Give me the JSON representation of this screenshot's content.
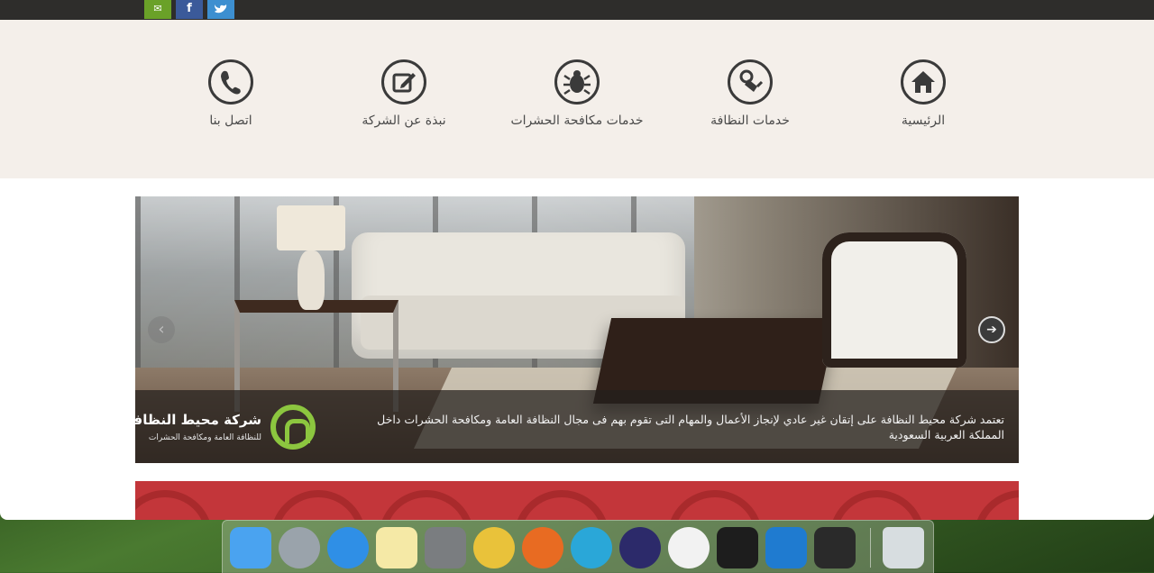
{
  "social": {
    "email_icon": "email-icon",
    "facebook_glyph": "f",
    "twitter_icon": "twitter-icon",
    "email_glyph": "✉"
  },
  "nav": {
    "items": [
      {
        "label": "الرئيسية",
        "icon": "home-icon"
      },
      {
        "label": "خدمات النظافة",
        "icon": "vacuum-cleaner-icon"
      },
      {
        "label": "خدمات مكافحة الحشرات",
        "icon": "bug-icon"
      },
      {
        "label": "نبذة عن الشركة",
        "icon": "edit-icon"
      },
      {
        "label": "اتصل بنا",
        "icon": "phone-icon"
      }
    ]
  },
  "slider": {
    "caption": "تعتمد شركة محيط النظافة على إتقان غير عادي لإنجاز الأعمال والمهام التى تقوم بهم فى مجال النظافة العامة ومكافحة الحشرات داخل المملكة العربية السعودية",
    "logo_name": "شركة محيط النظافة",
    "logo_sub": "للنظافة العامة ومكافحة الحشرات",
    "prev_arrow": "‹",
    "next_arrow": "➔"
  },
  "dock": {
    "apps": [
      {
        "name": "finder-icon",
        "color": "#4aa3f0"
      },
      {
        "name": "launchpad-icon",
        "color": "#9aa3ab"
      },
      {
        "name": "safari-icon",
        "color": "#2f8fe6"
      },
      {
        "name": "notes-icon",
        "color": "#f5e9a6"
      },
      {
        "name": "system-preferences-icon",
        "color": "#7a7d80"
      },
      {
        "name": "chrome-icon",
        "color": "#e9c23a"
      },
      {
        "name": "firefox-icon",
        "color": "#e86b22"
      },
      {
        "name": "kite-icon",
        "color": "#2aa7d8"
      },
      {
        "name": "eclipse-icon",
        "color": "#2c2a6a"
      },
      {
        "name": "photos-icon",
        "color": "#f2f2f2"
      },
      {
        "name": "terminal-icon",
        "color": "#1d1d1d"
      },
      {
        "name": "vscode-icon",
        "color": "#1f7bd0"
      },
      {
        "name": "screen-app-icon",
        "color": "#2a2a2a"
      },
      {
        "name": "trash-icon",
        "color": "#d7dde0"
      }
    ]
  }
}
